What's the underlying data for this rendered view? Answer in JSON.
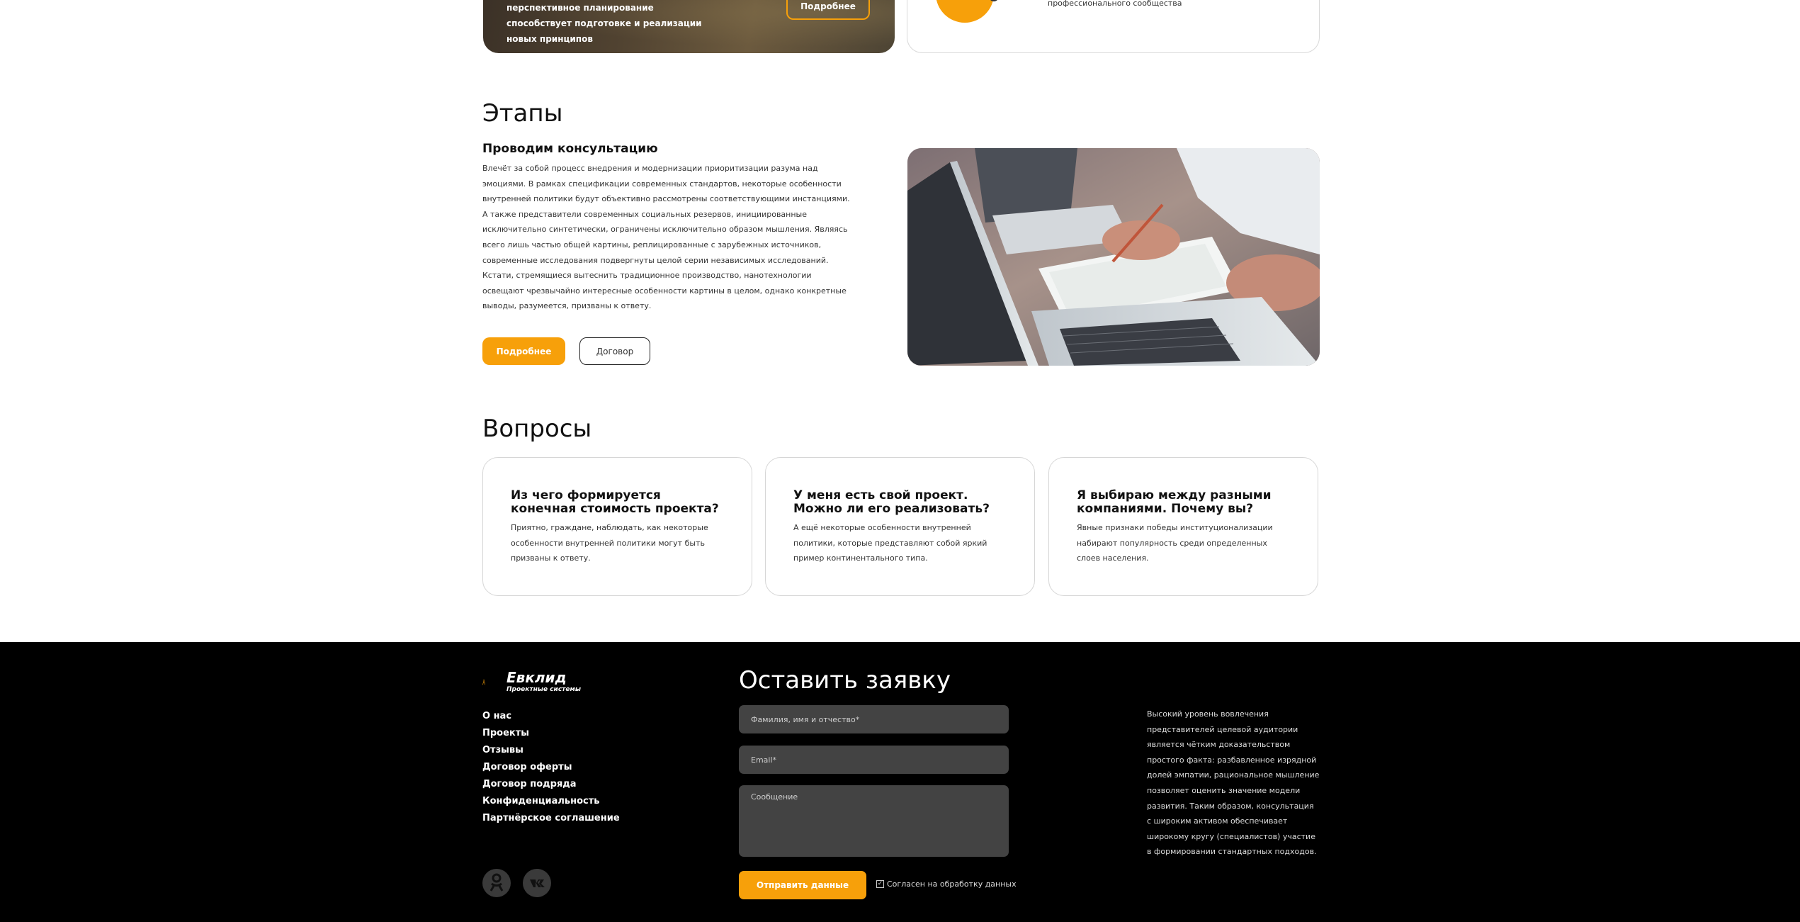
{
  "top": {
    "photo_card_text": "перспективное планирование способствует подготовке и реализации новых принципов",
    "photo_card_button": "Подробнее",
    "right_card_text": "профессионального сообщества"
  },
  "stages": {
    "title": "Этапы",
    "heading": "Проводим консультацию",
    "text": "Влечёт за собой процесс внедрения и модернизации приоритизации разума над эмоциями. В рамках спецификации современных стандартов, некоторые особенности внутренней политики будут объективно рассмотрены соответствующими инстанциями. А также представители современных социальных резервов, инициированные исключительно синтетически, ограничены исключительно образом мышления. Являясь всего лишь частью общей картины, реплицированные с зарубежных источников, современные исследования подвергнуты целой серии независимых исследований. Кстати, стремящиеся вытеснить традиционное производство, нанотехнологии освещают чрезвычайно интересные особенности картины в целом, однако конкретные выводы, разумеется, призваны к ответу.",
    "primary_button": "Подробнее",
    "secondary_button": "Договор"
  },
  "questions": {
    "title": "Вопросы",
    "items": [
      {
        "title": "Из чего формируется конечная стоимость проекта?",
        "text": "Приятно, граждане, наблюдать, как некоторые особенности внутренней политики могут быть призваны к ответу."
      },
      {
        "title": "У меня есть свой проект. Можно ли его реализовать?",
        "text": "А ещё некоторые особенности внутренней политики, которые представляют собой яркий пример континентального типа."
      },
      {
        "title": "Я выбираю между разными компаниями. Почему вы?",
        "text": "Явные признаки победы институционализации набирают популярность среди определенных слоев населения."
      }
    ]
  },
  "footer": {
    "logo_name": "Евклид",
    "logo_sub": "Проектные системы",
    "nav": [
      "О нас",
      "Проекты",
      "Отзывы",
      "Договор оферты",
      "Договор подряда",
      "Конфиденциальность",
      "Партнёрское соглашение"
    ],
    "form_title": "Оставить заявку",
    "name_placeholder": "Фамилия, имя и отчество*",
    "email_placeholder": "Email*",
    "message_placeholder": "Сообщение",
    "submit_label": "Отправить данные",
    "consent_label": "Согласен на обработку данных",
    "consent_checked": true,
    "description": "Высокий уровень вовлечения представителей целевой аудитории является чётким доказательством простого факта: разбавленное изрядной долей эмпатии, рациональное мышление позволяет оценить значение модели развития. Таким образом, консультация с широким активом обеспечивает широкому кругу (специалистов) участие в формировании стандартных подходов.",
    "social": [
      "odnoklassniki-icon",
      "vk-icon"
    ]
  },
  "colors": {
    "accent": "#f7a00a",
    "footer_bg": "#000000",
    "field_bg": "#434343"
  }
}
